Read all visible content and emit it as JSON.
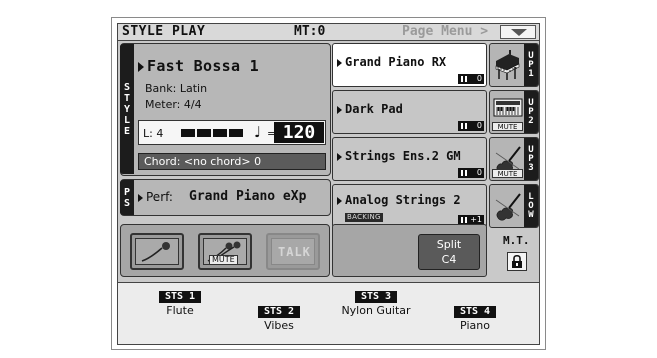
{
  "titlebar": {
    "title": "STYLE PLAY",
    "mt": "MT:0",
    "page_menu": "Page Menu >"
  },
  "style": {
    "side_label": [
      "S",
      "T",
      "Y",
      "L",
      "E"
    ],
    "name": "Fast Bossa 1",
    "bank": "Bank: Latin",
    "meter": "Meter: 4/4",
    "level": "L: 4",
    "note_symbol": "♩",
    "eq": "=",
    "tempo": "120",
    "chord": "Chord: <no chord> 0"
  },
  "performance": {
    "side_label": [
      "P",
      "S"
    ],
    "label": "Perf:",
    "name": "Grand Piano eXp"
  },
  "tracks": [
    {
      "sound": "Grand Piano RX",
      "octave": "0",
      "side_label": [
        "U",
        "P",
        "1"
      ],
      "icon": "grand-piano-icon",
      "badge": "",
      "selected": true,
      "backing": ""
    },
    {
      "sound": "Dark Pad",
      "octave": "0",
      "side_label": [
        "U",
        "P",
        "2"
      ],
      "icon": "keyboard-icon",
      "badge": "MUTE",
      "selected": false,
      "backing": ""
    },
    {
      "sound": "Strings Ens.2 GM",
      "octave": "0",
      "side_label": [
        "U",
        "P",
        "3"
      ],
      "icon": "violin-icon",
      "badge": "MUTE",
      "selected": false,
      "backing": ""
    },
    {
      "sound": "Analog Strings 2",
      "octave": "+1",
      "side_label": [
        "L",
        "O",
        "W"
      ],
      "icon": "violin-icon",
      "badge": "",
      "selected": false,
      "backing": "BACKING"
    }
  ],
  "controls": {
    "mic_button_icon": "microphone-icon",
    "mic_mute_label": "MUTE",
    "talk_label": "TALK",
    "split_label": "Split",
    "split_value": "C4",
    "mt_label": "M.T.",
    "lock_icon": "lock-icon"
  },
  "sts": [
    {
      "tag": "STS 1",
      "label": "Flute"
    },
    {
      "tag": "STS 2",
      "label": "Vibes"
    },
    {
      "tag": "STS 3",
      "label": "Nylon Guitar"
    },
    {
      "tag": "STS 4",
      "label": "Piano"
    }
  ],
  "colors": {
    "screen_bg": "#c9c9c9",
    "tab_dark": "#1c1c1c",
    "selected_slot": "#ffffff"
  }
}
